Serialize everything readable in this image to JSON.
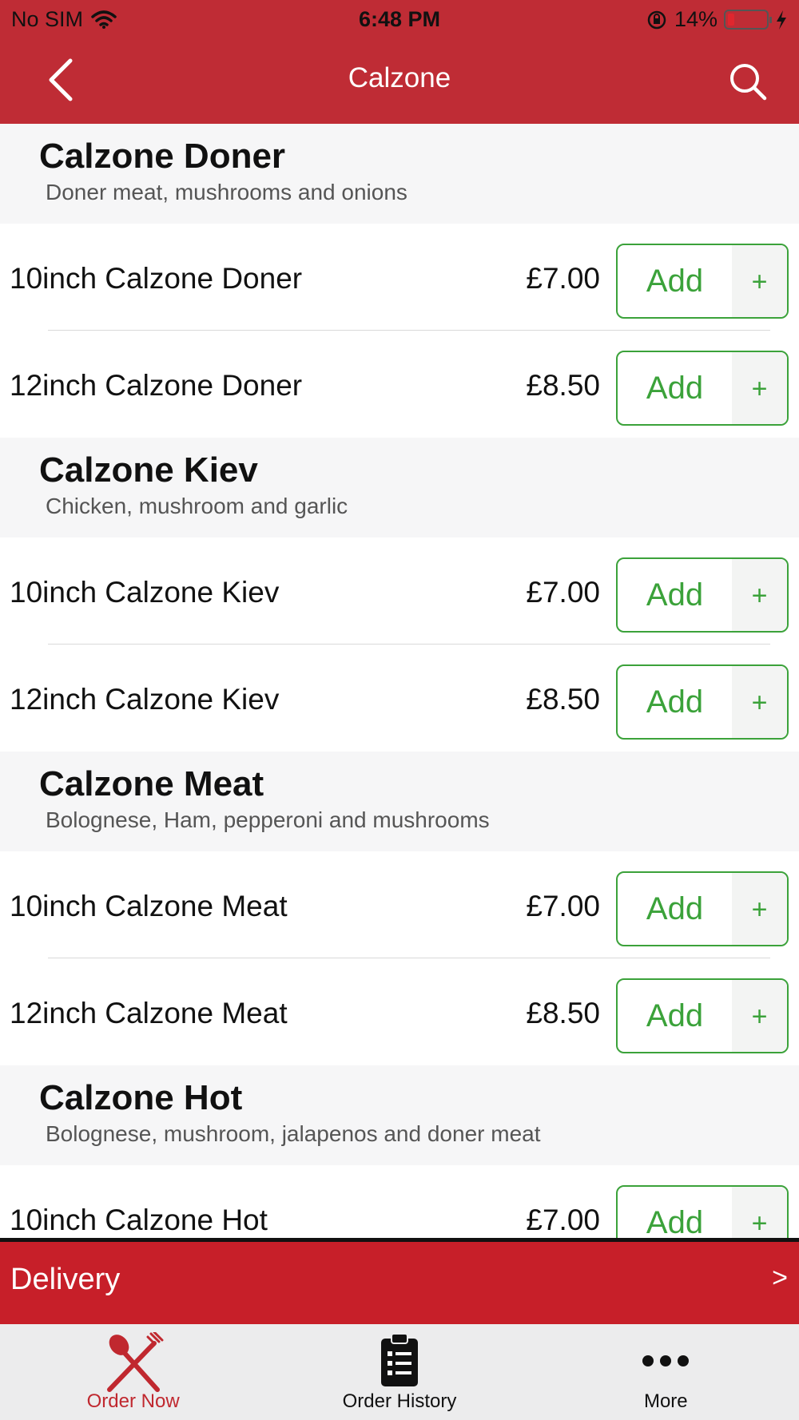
{
  "status_bar": {
    "carrier": "No SIM",
    "time": "6:48 PM",
    "battery": "14%"
  },
  "colors": {
    "brand": "#bf2c35",
    "accent_green": "#3ba23a",
    "delivery_bar": "#c71f29"
  },
  "header": {
    "title": "Calzone",
    "back_icon": "chevron-left-icon",
    "search_icon": "search-icon"
  },
  "sections": [
    {
      "title": "Calzone Doner",
      "description": "Doner meat, mushrooms and onions",
      "items": [
        {
          "name": "10inch Calzone Doner",
          "price": "£7.00",
          "add_label": "Add",
          "plus": "+"
        },
        {
          "name": "12inch Calzone Doner",
          "price": "£8.50",
          "add_label": "Add",
          "plus": "+"
        }
      ]
    },
    {
      "title": "Calzone Kiev",
      "description": "Chicken, mushroom and garlic",
      "items": [
        {
          "name": "10inch Calzone Kiev",
          "price": "£7.00",
          "add_label": "Add",
          "plus": "+"
        },
        {
          "name": "12inch Calzone Kiev",
          "price": "£8.50",
          "add_label": "Add",
          "plus": "+"
        }
      ]
    },
    {
      "title": "Calzone Meat",
      "description": "Bolognese, Ham, pepperoni and mushrooms",
      "items": [
        {
          "name": "10inch Calzone Meat",
          "price": "£7.00",
          "add_label": "Add",
          "plus": "+"
        },
        {
          "name": "12inch Calzone Meat",
          "price": "£8.50",
          "add_label": "Add",
          "plus": "+"
        }
      ]
    },
    {
      "title": "Calzone Hot",
      "description": "Bolognese, mushroom, jalapenos and doner meat",
      "items": [
        {
          "name": "10inch Calzone Hot",
          "price": "£7.00",
          "add_label": "Add",
          "plus": "+"
        }
      ]
    }
  ],
  "delivery": {
    "label": "Delivery",
    "chevron": ">"
  },
  "tabs": [
    {
      "label": "Order Now",
      "icon": "fork-knife-icon",
      "active": true
    },
    {
      "label": "Order History",
      "icon": "clipboard-list-icon",
      "active": false
    },
    {
      "label": "More",
      "icon": "more-dots-icon",
      "active": false
    }
  ]
}
